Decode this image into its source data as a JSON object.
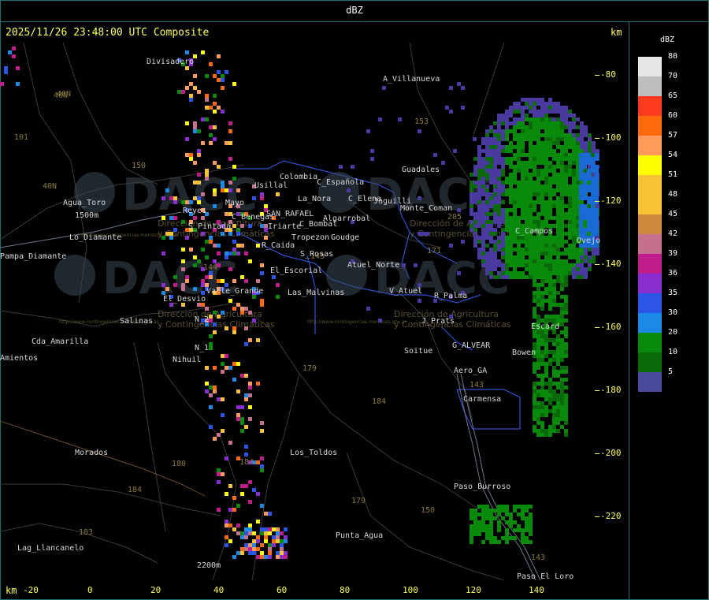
{
  "header": {
    "title": "dBZ"
  },
  "timestamp": "2025/11/26 23:48:00 UTC Composite",
  "units": {
    "top": "km",
    "bottom": "km"
  },
  "legend": {
    "title": "dBZ",
    "levels": [
      {
        "label": "80",
        "color": "#e6e6e6"
      },
      {
        "label": "70",
        "color": "#bebebe"
      },
      {
        "label": "65",
        "color": "#ff3a1e"
      },
      {
        "label": "60",
        "color": "#ff6a0a"
      },
      {
        "label": "57",
        "color": "#ff9a5a"
      },
      {
        "label": "54",
        "color": "#ffff00"
      },
      {
        "label": "51",
        "color": "#f6c236"
      },
      {
        "label": "48",
        "color": "#f6c236"
      },
      {
        "label": "45",
        "color": "#cd8a3e"
      },
      {
        "label": "42",
        "color": "#c4708e"
      },
      {
        "label": "39",
        "color": "#c01c8c"
      },
      {
        "label": "36",
        "color": "#8a2ed2"
      },
      {
        "label": "35",
        "color": "#2a55e6"
      },
      {
        "label": "30",
        "color": "#1a8ae6"
      },
      {
        "label": "20",
        "color": "#0a8a0a"
      },
      {
        "label": "10",
        "color": "#0a6a0a"
      },
      {
        "label": "5",
        "color": "#4a4a9a"
      }
    ]
  },
  "axes": {
    "y_ticks": [
      "-80",
      "-100",
      "-120",
      "-140",
      "-160",
      "-180",
      "-200",
      "-220"
    ],
    "x_ticks": [
      "-20",
      "0",
      "20",
      "40",
      "60",
      "80",
      "100",
      "120",
      "140"
    ]
  },
  "places": [
    "Divisadero",
    "A_Villanueva",
    "Agua_Toro",
    "Pampa_Diamante",
    "Usillal",
    "Colombia",
    "C_Española",
    "La_Nora",
    "C_Elena",
    "Jaguilli",
    "Guadales",
    "Monte_Coman",
    "C_Benegas",
    "SAN_RAFAEL",
    "Algarrobal",
    "C_Bombal",
    "Reyes",
    "S_Pintada",
    "Iriarte",
    "R_Caida",
    "Tropezon",
    "Goudge",
    "S_Rosas",
    "El_Escorial",
    "Atuel_Norte",
    "Valle_Grande",
    "Las_Malvinas",
    "El_Desvio",
    "V_Atuel",
    "R_Palma",
    "Salinas",
    "J_Prats",
    "N_2",
    "N_1",
    "Nihuil",
    "Cda_Amarilla",
    "Amientos",
    "G_ALVEAR",
    "Bowen",
    "Soitue",
    "Aero_GA",
    "Carmensa",
    "Morados",
    "Los_Toldos",
    "Paso_Burroso",
    "Lag_Llancanelo",
    "Punta_Agua",
    "Paso_El_Loro",
    "C_Campos",
    "Ovejo",
    "Escard",
    "Lo_Diamante",
    "2200m",
    "1500m",
    "Mayo"
  ],
  "routes": [
    "40N",
    "101",
    "150",
    "40N",
    "153",
    "144",
    "171",
    "143",
    "184",
    "179",
    "180",
    "184",
    "183",
    "184",
    "179",
    "150",
    "143",
    "143",
    "205",
    "40N"
  ],
  "watermark": {
    "logo": "DACC",
    "line1": "Dirección de Agricultura",
    "line2": "y Contingencias Climáticas",
    "url": "http://www.contingencias.mendoza.gov.ar"
  }
}
